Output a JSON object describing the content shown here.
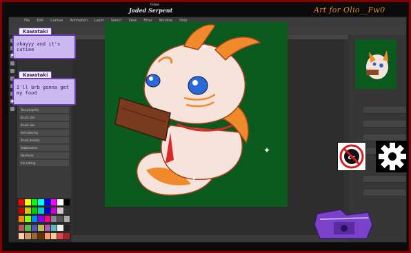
{
  "menu": [
    "File",
    "Edit",
    "Canvas",
    "Animation",
    "Layer",
    "Select",
    "View",
    "Filter",
    "Window",
    "Help"
  ],
  "canvas_credit": "Jaded Serpent",
  "credit_sub": "Follow",
  "overlay_title": "Art for Olio__Fw0",
  "chat": [
    {
      "name": "Kawataki",
      "message": "okayyy and it's cutiee"
    },
    {
      "name": "Kawataki",
      "message": "I'll brb gonna get my food"
    }
  ],
  "left_panel_rows": [
    "Tool property",
    "Brush size",
    "Brush size",
    "Anti-aliasing",
    "Brush density",
    "Stabilization",
    "Hardness",
    "Ink setting"
  ],
  "colors": {
    "accent": "#6a3fb5",
    "canvas": "#0a5a1d",
    "frame": "#8a0000",
    "orange": "#f08a2a"
  },
  "icons": [
    "cc-off-icon",
    "gear-icon",
    "sparkle-icon"
  ]
}
